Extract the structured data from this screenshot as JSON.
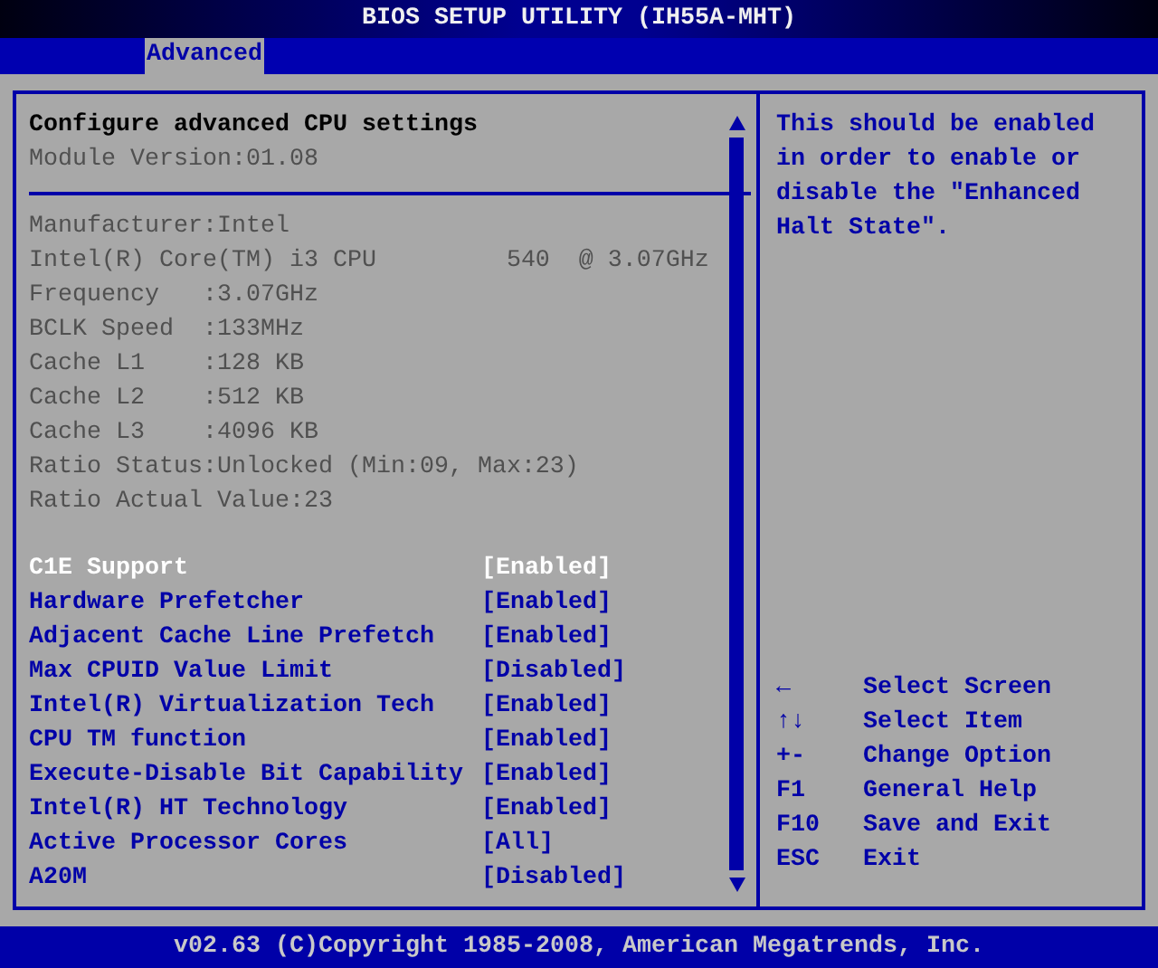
{
  "window": {
    "title": "BIOS SETUP UTILITY (IH55A-MHT)"
  },
  "tabs": [
    {
      "label": "Advanced",
      "selected": true
    }
  ],
  "panel": {
    "heading": "Configure advanced CPU settings",
    "module_version": "Module Version:01.08",
    "info_lines": [
      "Manufacturer:Intel",
      "Intel(R) Core(TM) i3 CPU         540  @ 3.07GHz",
      "Frequency   :3.07GHz",
      "BCLK Speed  :133MHz",
      "Cache L1    :128 KB",
      "Cache L2    :512 KB",
      "Cache L3    :4096 KB",
      "Ratio Status:Unlocked (Min:09, Max:23)",
      "Ratio Actual Value:23"
    ],
    "settings": [
      {
        "name": "C1E Support",
        "value": "[Enabled]",
        "selected": true
      },
      {
        "name": "Hardware Prefetcher",
        "value": "[Enabled]",
        "selected": false
      },
      {
        "name": "Adjacent Cache Line Prefetch",
        "value": "[Enabled]",
        "selected": false
      },
      {
        "name": "Max CPUID Value Limit",
        "value": "[Disabled]",
        "selected": false
      },
      {
        "name": "Intel(R) Virtualization Tech",
        "value": "[Enabled]",
        "selected": false
      },
      {
        "name": "CPU TM function",
        "value": "[Enabled]",
        "selected": false
      },
      {
        "name": "Execute-Disable Bit Capability",
        "value": "[Enabled]",
        "selected": false
      },
      {
        "name": "Intel(R) HT Technology",
        "value": "[Enabled]",
        "selected": false
      },
      {
        "name": "Active Processor Cores",
        "value": "[All]",
        "selected": false
      },
      {
        "name": "A20M",
        "value": "[Disabled]",
        "selected": false
      }
    ]
  },
  "help": {
    "text": "This should be enabled in order to enable or disable the \"Enhanced Halt State\".",
    "keys": [
      {
        "key": "←",
        "action": "Select Screen"
      },
      {
        "key": "↑↓",
        "action": "Select Item"
      },
      {
        "key": "+-",
        "action": "Change Option"
      },
      {
        "key": "F1",
        "action": "General Help"
      },
      {
        "key": "F10",
        "action": "Save and Exit"
      },
      {
        "key": "ESC",
        "action": "Exit"
      }
    ]
  },
  "status_bar": "v02.63 (C)Copyright 1985-2008, American Megatrends, Inc."
}
